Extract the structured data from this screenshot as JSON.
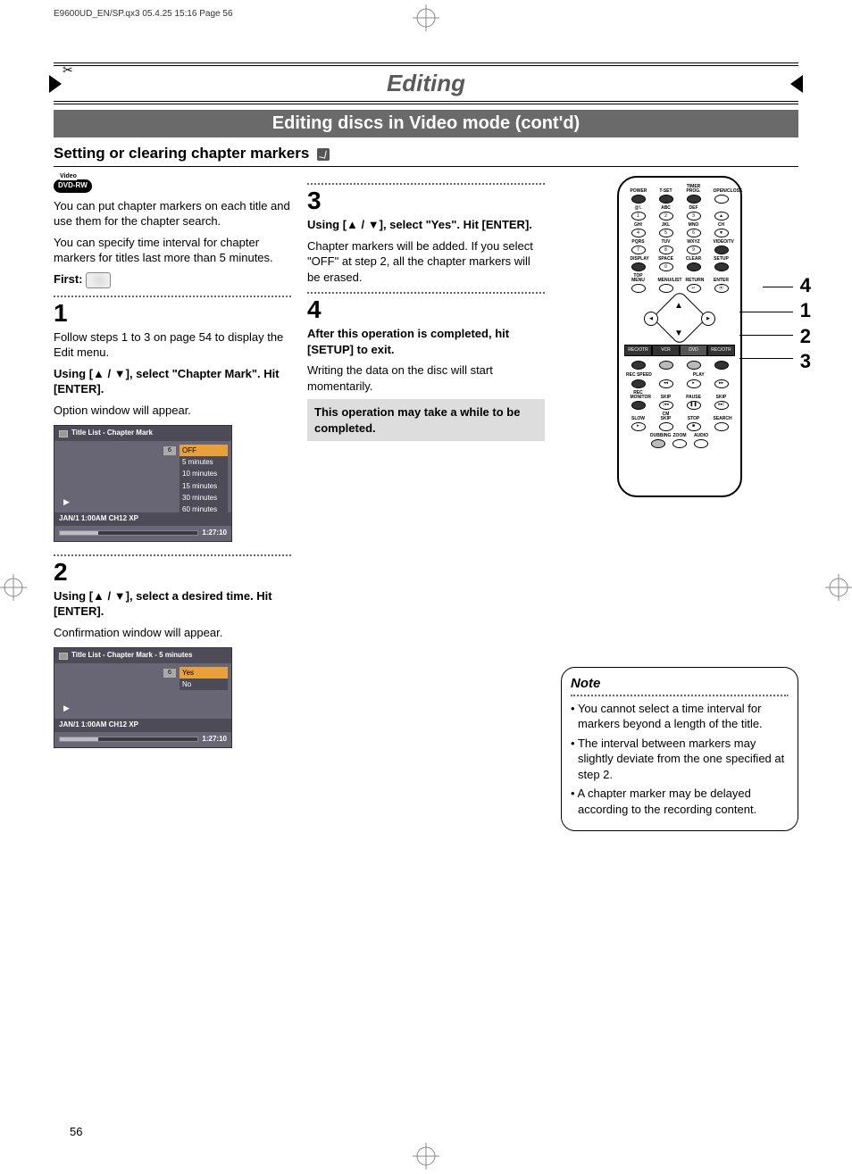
{
  "header_line": "E9600UD_EN/SP.qx3  05.4.25 15:16  Page 56",
  "title": "Editing",
  "subtitle": "Editing discs in Video mode (cont'd)",
  "section_heading": "Setting or clearing chapter markers",
  "dvdrw_badge_top": "Video",
  "dvdrw_badge": "DVD-RW",
  "intro_p1": "You can put chapter markers on each title and use them for the chapter search.",
  "intro_p2": "You can specify time interval for chapter markers for titles last more than 5 minutes.",
  "first_label": "First:",
  "step1": {
    "num": "1",
    "p1": "Follow steps 1 to 3 on page 54 to display the Edit menu.",
    "p2": "Using [▲ / ▼], select \"Chapter Mark\". Hit [ENTER].",
    "p3": "Option window will appear."
  },
  "ui1": {
    "title": "Title List - Chapter Mark",
    "thumb": "6",
    "menu": [
      "OFF",
      "5 minutes",
      "10 minutes",
      "15 minutes",
      "30 minutes",
      "60 minutes"
    ],
    "selected": "OFF",
    "info": "JAN/1 1:00AM CH12 XP",
    "time": "1:27:10"
  },
  "step2": {
    "num": "2",
    "p1": "Using [▲ / ▼], select a desired time. Hit [ENTER].",
    "p2": "Confirmation window will appear."
  },
  "ui2": {
    "title": "Title List - Chapter Mark - 5 minutes",
    "thumb": "6",
    "menu": [
      "Yes",
      "No"
    ],
    "selected": "Yes",
    "info": "JAN/1 1:00AM CH12 XP",
    "time": "1:27:10"
  },
  "step3": {
    "num": "3",
    "p1": "Using [▲ / ▼], select \"Yes\". Hit [ENTER].",
    "p2": "Chapter markers will be added. If you select \"OFF\" at step 2, all the chapter markers will be erased."
  },
  "step4": {
    "num": "4",
    "p1": "After this operation is completed, hit [SETUP] to exit.",
    "p2": "Writing the data on the disc will start momentarily.",
    "callout": "This operation may take a while to be completed."
  },
  "note": {
    "title": "Note",
    "items": [
      "You cannot select a time interval for markers beyond a length of the title.",
      "The interval between markers may slightly deviate from the one specified at step 2.",
      "A chapter marker may be delayed according to the recording content."
    ]
  },
  "remote": {
    "row_top": [
      {
        "lbl": "POWER",
        "cls": "dark"
      },
      {
        "lbl": "T-SET",
        "cls": "dark"
      },
      {
        "lbl": "TIMER PROG.",
        "cls": "dark"
      },
      {
        "lbl": "OPEN/CLOSE",
        "cls": ""
      }
    ],
    "numpad": [
      [
        {
          "lbl": "@!.",
          "t": "1"
        },
        {
          "lbl": "ABC",
          "t": "2"
        },
        {
          "lbl": "DEF",
          "t": "3"
        },
        {
          "lbl": "",
          "t": "▲"
        }
      ],
      [
        {
          "lbl": "GHI",
          "t": "4"
        },
        {
          "lbl": "JKL",
          "t": "5"
        },
        {
          "lbl": "MNO",
          "t": "6"
        },
        {
          "lbl": "CH",
          "t": "▼"
        }
      ],
      [
        {
          "lbl": "PQRS",
          "t": "7"
        },
        {
          "lbl": "TUV",
          "t": "8"
        },
        {
          "lbl": "WXYZ",
          "t": "9"
        },
        {
          "lbl": "VIDEO/TV",
          "t": "",
          "cls": "dark"
        }
      ],
      [
        {
          "lbl": "DISPLAY",
          "t": "",
          "cls": "dark"
        },
        {
          "lbl": "SPACE",
          "t": "0"
        },
        {
          "lbl": "CLEAR",
          "t": "",
          "cls": "dark"
        },
        {
          "lbl": "SETUP",
          "t": "",
          "cls": "dark"
        }
      ],
      [
        {
          "lbl": "TOP MENU",
          "t": ""
        },
        {
          "lbl": "MENU/LIST",
          "t": ""
        },
        {
          "lbl": "RETURN",
          "t": "↵"
        },
        {
          "lbl": "ENTER",
          "t": "⦿"
        }
      ]
    ],
    "tabs": [
      {
        "t": "REC/OTR",
        "cls": "dark"
      },
      {
        "t": "VCR",
        "cls": "dark"
      },
      {
        "t": "DVD",
        "cls": "dark2"
      },
      {
        "t": "REC/OTR",
        "cls": "dark"
      }
    ],
    "tab_btns": [
      {
        "cls": "dark"
      },
      {
        "cls": "grey"
      },
      {
        "cls": "grey"
      },
      {
        "cls": "dark"
      }
    ],
    "play_row_lbl_left": "REC SPEED",
    "play_row_lbl_right": "PLAY",
    "play_row": [
      {
        "lbl": "",
        "t": "",
        "cls": "dark"
      },
      {
        "lbl": "",
        "t": "◂◂"
      },
      {
        "lbl": "",
        "t": "▸"
      },
      {
        "lbl": "",
        "t": "▸▸"
      }
    ],
    "skip_row": [
      {
        "lbl": "REC MONITOR",
        "t": "",
        "cls": "dark"
      },
      {
        "lbl": "SKIP",
        "t": "|◂◂"
      },
      {
        "lbl": "PAUSE",
        "t": "❚❚"
      },
      {
        "lbl": "SKIP",
        "t": "▸▸|"
      }
    ],
    "stop_row": [
      {
        "lbl": "SLOW",
        "t": "▸"
      },
      {
        "lbl": "CM SKIP",
        "t": ""
      },
      {
        "lbl": "STOP",
        "t": "■"
      },
      {
        "lbl": "SEARCH",
        "t": ""
      }
    ],
    "bottom_row": [
      {
        "lbl": "DUBBING",
        "cls": "grey"
      },
      {
        "lbl": "ZOOM",
        "cls": ""
      },
      {
        "lbl": "AUDIO",
        "cls": ""
      }
    ],
    "callouts": [
      "4",
      "1",
      "2",
      "3"
    ]
  },
  "page_number": "56"
}
